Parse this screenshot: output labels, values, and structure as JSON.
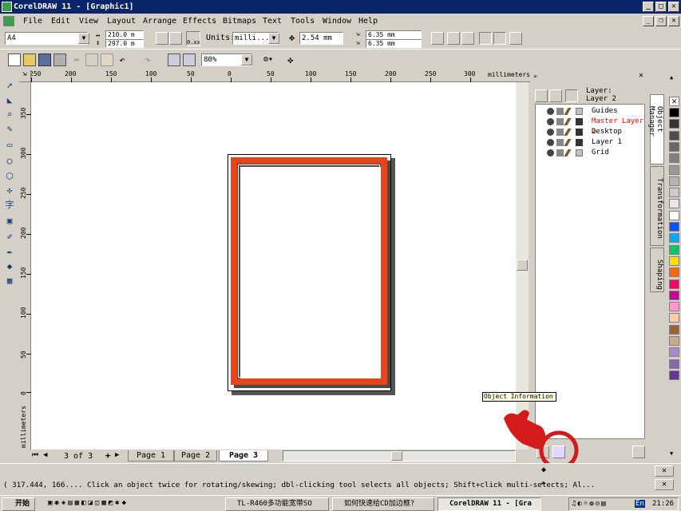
{
  "window": {
    "title": "CorelDRAW 11 - [Graphic1]"
  },
  "menu": [
    "File",
    "Edit",
    "View",
    "Layout",
    "Arrange",
    "Effects",
    "Bitmaps",
    "Text",
    "Tools",
    "Window",
    "Help"
  ],
  "property_bar": {
    "paper_size": "A4",
    "width": "210.0 m",
    "height": "297.0 m",
    "units_label": "Units:",
    "units_value": "milli...",
    "nudge_value": "2.54 mm",
    "dup_x": "6.35 mm",
    "dup_y": "6.35 mm",
    "x0_label": "0.xx"
  },
  "standard_bar": {
    "zoom": "80%"
  },
  "ruler": {
    "unit": "millimeters",
    "h_labels": [
      "250",
      "200",
      "150",
      "100",
      "50",
      "0",
      "50",
      "100",
      "150",
      "200",
      "250",
      "300"
    ],
    "v_labels": [
      "350",
      "300",
      "250",
      "200",
      "150",
      "100",
      "50",
      "0"
    ],
    "v_unit": "millimeters"
  },
  "page_nav": {
    "counter": "3 of 3",
    "tabs": [
      "Page 1",
      "Page 2",
      "Page 3"
    ],
    "active": "Page 3"
  },
  "object_manager": {
    "header_line1": "Layer:",
    "header_line2": "Layer 2",
    "layers": [
      {
        "name": "Guides",
        "color": "#000000",
        "swatch": "#c0c0c0"
      },
      {
        "name": "Master Layer 2",
        "color": "#ff0000",
        "swatch": "#333333"
      },
      {
        "name": "Desktop",
        "color": "#000000",
        "swatch": "#333333"
      },
      {
        "name": "Layer 1",
        "color": "#000000",
        "swatch": "#333333"
      },
      {
        "name": "Grid",
        "color": "#000000",
        "swatch": "#c0c0c0"
      }
    ]
  },
  "docker_tabs": [
    "Object Manager",
    "Transformation",
    "Shaping"
  ],
  "tooltip": "Object Information",
  "status": {
    "line1": "( 317.444, 166.... Click an object twice for rotating/skewing; dbl-clicking tool selects all objects; Shift+click multi-selects; Al..."
  },
  "taskbar": {
    "start": "开始",
    "items": [
      "TL-R460多功能宽带SO",
      "如何快速给CD加边框?",
      "CorelDRAW 11 - [Gra"
    ],
    "tray_lang": "En",
    "clock": "21:26"
  },
  "colors": {
    "titlebar": "#0a246a",
    "frame_orange": "#e8441a",
    "palette": [
      "#000000",
      "#333333",
      "#4d4d4d",
      "#666666",
      "#808080",
      "#999999",
      "#b3b3b3",
      "#cccccc",
      "#e6e6e6",
      "#ffffff",
      "#0055ff",
      "#00aaff",
      "#00cc66",
      "#ffdd00",
      "#ff6600",
      "#ff0066",
      "#cc0099",
      "#ff99cc",
      "#ffccaa",
      "#996633",
      "#ccaa88",
      "#aa88cc",
      "#8866aa",
      "#663399"
    ]
  }
}
